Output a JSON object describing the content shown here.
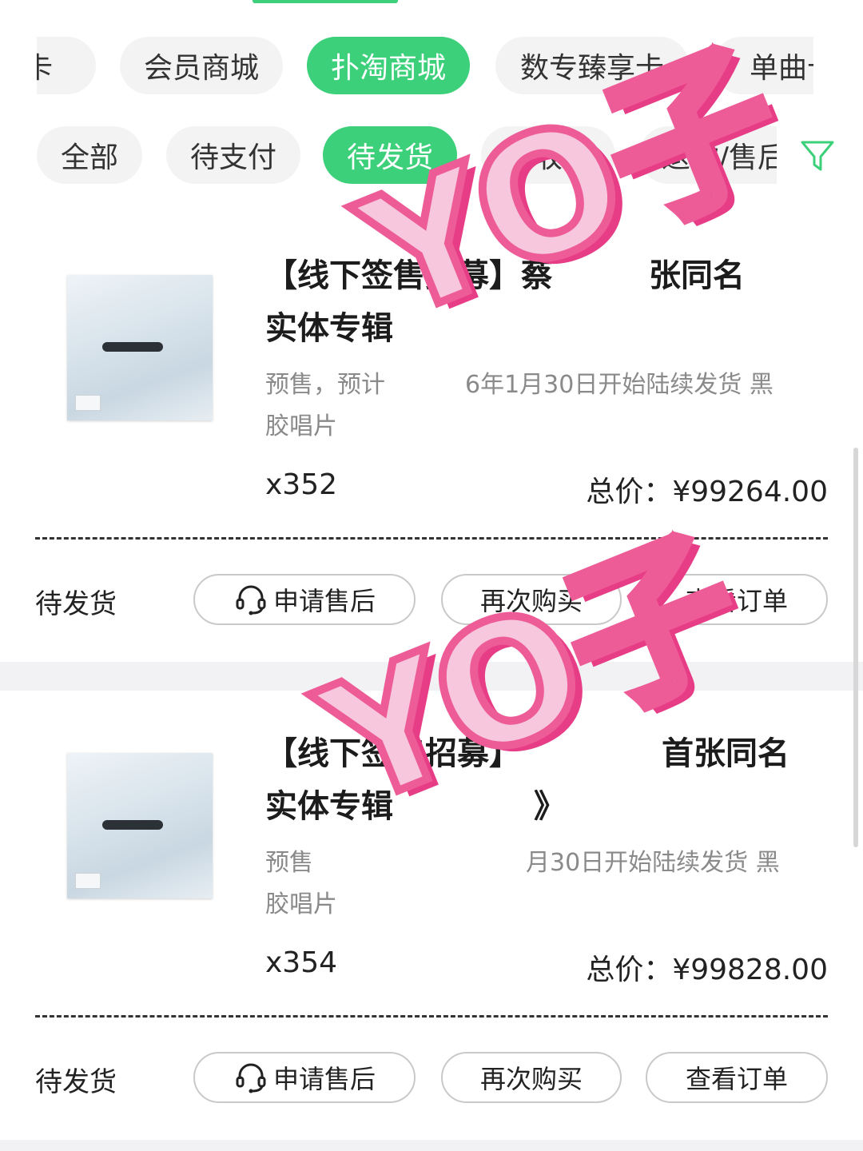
{
  "top_tabs": [
    {
      "label": "卡",
      "active": false
    },
    {
      "label": "会员商城",
      "active": false
    },
    {
      "label": "扑淘商城",
      "active": true
    },
    {
      "label": "数专臻享卡",
      "active": false
    },
    {
      "label": "单曲卡",
      "active": false
    }
  ],
  "status_tabs": [
    {
      "label": "全部",
      "active": false
    },
    {
      "label": "待支付",
      "active": false
    },
    {
      "label": "待发货",
      "active": true
    },
    {
      "label": "待收货",
      "active": false
    },
    {
      "label": "退款/售后",
      "active": false
    }
  ],
  "filter_icon": "filter-icon",
  "orders": [
    {
      "title": "【线下签售招募】蔡",
      "title_tail": "张同名",
      "title_line2": "实体专辑",
      "desc_left": "预售，预计",
      "desc_right": "6年1月30日开始陆续发货 黑",
      "desc_line2": "胶唱片",
      "qty": "x352",
      "total": "总价：¥99264.00",
      "status": "待发货",
      "btn_service": "申请售后",
      "btn_rebuy": "再次购买",
      "btn_view": "查看订单"
    },
    {
      "title": "【线下签售招募】",
      "title_tail": "首张同名",
      "title_line2": "实体专辑",
      "title_line2_tail": "》",
      "desc_left": "预售",
      "desc_right": "月30日开始陆续发货 黑",
      "desc_line2": "胶唱片",
      "qty": "x354",
      "total": "总价：¥99828.00",
      "status": "待发货",
      "btn_service": "申请售后",
      "btn_rebuy": "再次购买",
      "btn_view": "查看订单"
    }
  ],
  "watermark": "YO子",
  "colors": {
    "accent": "#3dd07a",
    "watermark_fill": "#f7c8dd",
    "watermark_stroke": "#ee5c98"
  }
}
